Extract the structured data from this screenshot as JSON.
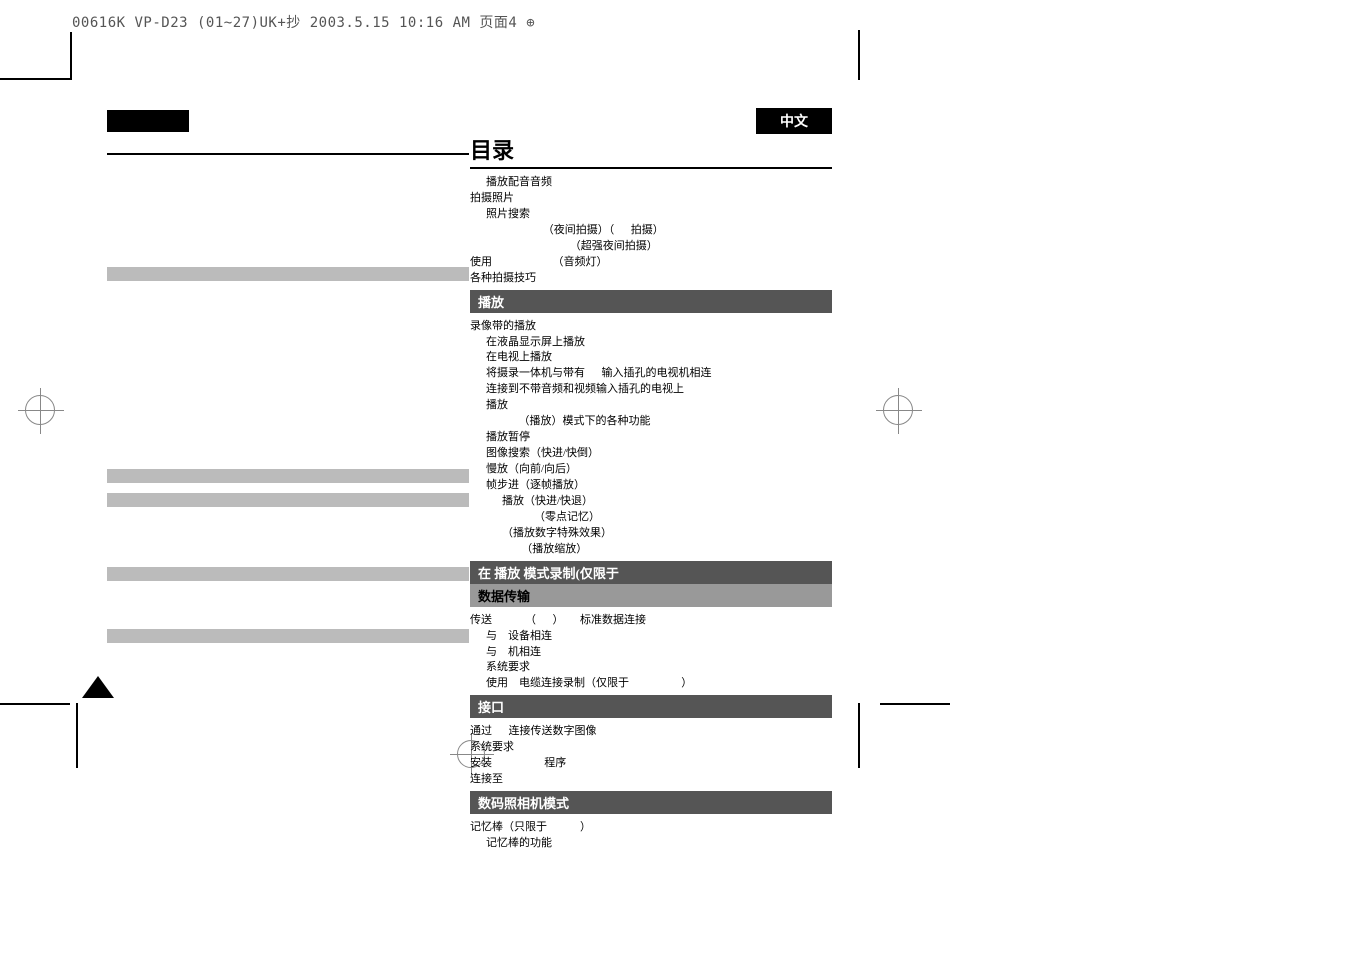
{
  "page_header": "00616K VP-D23 (01~27)UK+抄 2003.5.15 10:16 AM 页面4",
  "lang_badge": "中文",
  "main_title": "目录",
  "intro_items": [
    {
      "level": 1,
      "text": "播放配音音频"
    },
    {
      "level": 0,
      "text": "拍摄照片"
    },
    {
      "level": 1,
      "text": "照片搜索"
    },
    {
      "level": 3,
      "text": "         （夜间拍摄）（      拍摄）"
    },
    {
      "level": 4,
      "text": "             （超强夜间拍摄）"
    },
    {
      "level": 0,
      "text": "使用                      （音频灯）"
    },
    {
      "level": 0,
      "text": "各种拍摄技巧"
    }
  ],
  "sections": [
    {
      "title": "播放",
      "style": "dark",
      "items": [
        {
          "level": 0,
          "text": "录像带的播放"
        },
        {
          "level": 1,
          "text": "在液晶显示屏上播放"
        },
        {
          "level": 1,
          "text": "在电视上播放"
        },
        {
          "level": 1,
          "text": "将摄录一体机与带有      输入插孔的电视机相连"
        },
        {
          "level": 1,
          "text": "连接到不带音频和视频输入插孔的电视上"
        },
        {
          "level": 1,
          "text": "播放"
        },
        {
          "level": 2,
          "text": "      （播放）模式下的各种功能"
        },
        {
          "level": 1,
          "text": "播放暂停"
        },
        {
          "level": 1,
          "text": "图像搜索（快进/快倒）"
        },
        {
          "level": 1,
          "text": "慢放（向前/向后）"
        },
        {
          "level": 1,
          "text": "帧步进（逐帧播放）"
        },
        {
          "level": 2,
          "text": "播放（快进/快退）"
        },
        {
          "level": 4,
          "text": "（零点记忆）"
        },
        {
          "level": 2,
          "text": "（播放数字特殊效果）"
        },
        {
          "level": 2,
          "text": "       （播放缩放）"
        }
      ]
    },
    {
      "title": "在             播放 模式录制(仅限于",
      "style": "dark",
      "items": []
    },
    {
      "title": "                     数据传输",
      "style": "light",
      "items": [
        {
          "level": 0,
          "text": "传送            （      ）      标准数据连接"
        },
        {
          "level": 1,
          "text": "与    设备相连"
        },
        {
          "level": 1,
          "text": "与    机相连"
        },
        {
          "level": 1,
          "text": "系统要求"
        },
        {
          "level": 1,
          "text": "使用    电缆连接录制（仅限于                   ）"
        }
      ]
    },
    {
      "title": "         接口",
      "style": "dark",
      "items": [
        {
          "level": 0,
          "text": "通过      连接传送数字图像"
        },
        {
          "level": 0,
          "text": "系统要求"
        },
        {
          "level": 0,
          "text": "安装                   程序"
        },
        {
          "level": 0,
          "text": "连接至"
        }
      ]
    },
    {
      "title": "数码照相机模式",
      "style": "dark",
      "items": [
        {
          "level": 0,
          "text": "记忆棒（只限于            ）"
        },
        {
          "level": 1,
          "text": "记忆棒的功能"
        }
      ]
    }
  ]
}
